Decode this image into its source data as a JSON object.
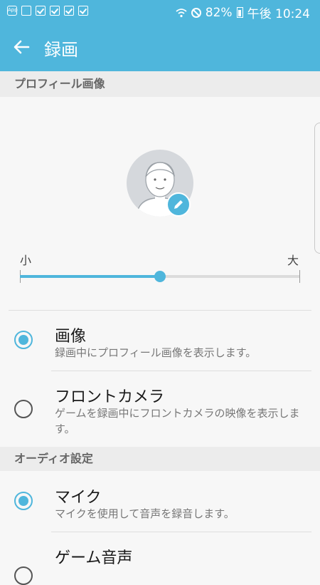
{
  "status_bar": {
    "left_icons": [
      "app-notification-icon",
      "image-notification-icon",
      "task-done-icon",
      "task-done-icon",
      "task-done-icon",
      "task-done-icon"
    ],
    "app_badge": "App",
    "battery": "82%",
    "time": "午後 10:24"
  },
  "app_bar": {
    "title": "録画",
    "back_icon": "arrow-left-icon",
    "background": "#4fb6dc"
  },
  "profile_section": {
    "header": "プロフィール画像",
    "size_slider": {
      "min_label": "小",
      "max_label": "大",
      "value": 0.5
    }
  },
  "profile_options": [
    {
      "title": "画像",
      "description": "録画中にプロフィール画像を表示します。",
      "selected": true
    },
    {
      "title": "フロントカメラ",
      "description": "ゲームを録画中にフロントカメラの映像を表示します。",
      "selected": false
    }
  ],
  "audio_section": {
    "header": "オーディオ設定"
  },
  "audio_options": [
    {
      "title": "マイク",
      "description": "マイクを使用して音声を録音します。",
      "selected": true
    },
    {
      "title": "ゲーム音声",
      "description": "",
      "selected": false
    }
  ],
  "colors": {
    "accent": "#4fb6dc",
    "section_bg": "#ececec"
  }
}
